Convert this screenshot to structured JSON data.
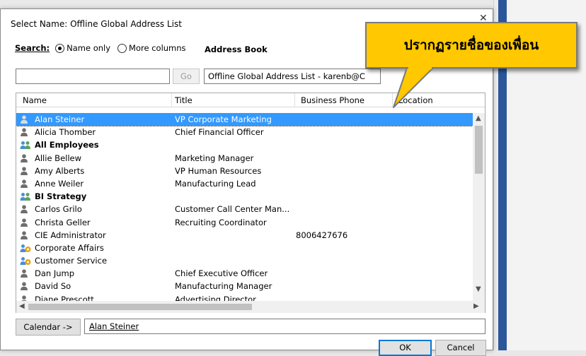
{
  "dialog": {
    "title": "Select Name: Offline Global Address List",
    "close_glyph": "✕"
  },
  "search": {
    "label": "Search:",
    "option_name_only": "Name only",
    "option_more_columns": "More columns",
    "selected_option": "Name only",
    "input_value": "",
    "go_label": "Go"
  },
  "address_book": {
    "label": "Address Book",
    "selected": "Offline Global Address List - karenb@C"
  },
  "columns": [
    "Name",
    "Title",
    "Business Phone",
    "Location"
  ],
  "rows": [
    {
      "name": "Alan Steiner",
      "title": "VP Corporate Marketing",
      "phone": "",
      "type": "person",
      "selected": true
    },
    {
      "name": "Alicia Thomber",
      "title": "Chief Financial Officer",
      "phone": "",
      "type": "person"
    },
    {
      "name": "All Employees",
      "title": "",
      "phone": "",
      "type": "group"
    },
    {
      "name": "Allie Bellew",
      "title": "Marketing Manager",
      "phone": "",
      "type": "person"
    },
    {
      "name": "Amy Alberts",
      "title": "VP Human Resources",
      "phone": "",
      "type": "person"
    },
    {
      "name": "Anne Weiler",
      "title": "Manufacturing Lead",
      "phone": "",
      "type": "person"
    },
    {
      "name": "BI Strategy",
      "title": "",
      "phone": "",
      "type": "group"
    },
    {
      "name": "Carlos Grilo",
      "title": "Customer Call Center Man...",
      "phone": "",
      "type": "person"
    },
    {
      "name": "Christa Geller",
      "title": "Recruiting Coordinator",
      "phone": "",
      "type": "person"
    },
    {
      "name": "CIE Administrator",
      "title": "",
      "phone": "8006427676",
      "type": "person"
    },
    {
      "name": "Corporate Affairs",
      "title": "",
      "phone": "",
      "type": "dl"
    },
    {
      "name": "Customer Service",
      "title": "",
      "phone": "",
      "type": "dl"
    },
    {
      "name": "Dan Jump",
      "title": "Chief Executive Officer",
      "phone": "",
      "type": "person"
    },
    {
      "name": "David So",
      "title": "Manufacturing Manager",
      "phone": "",
      "type": "person"
    },
    {
      "name": "Diane Prescott",
      "title": "Advertising Director",
      "phone": "",
      "type": "person"
    }
  ],
  "calendar": {
    "button_label": "Calendar ->",
    "value": "Alan Steiner"
  },
  "buttons": {
    "ok": "OK",
    "cancel": "Cancel"
  },
  "callout": {
    "text": "ปรากฏรายชื่อของเพื่อน",
    "color": "#ffc800"
  },
  "colors": {
    "selection": "#3399ff",
    "person_icon": "#6e6e6e",
    "group_icon_left": "#4a8fd4",
    "group_icon_right": "#5aa45a",
    "dl_badge": "#e8a317"
  }
}
